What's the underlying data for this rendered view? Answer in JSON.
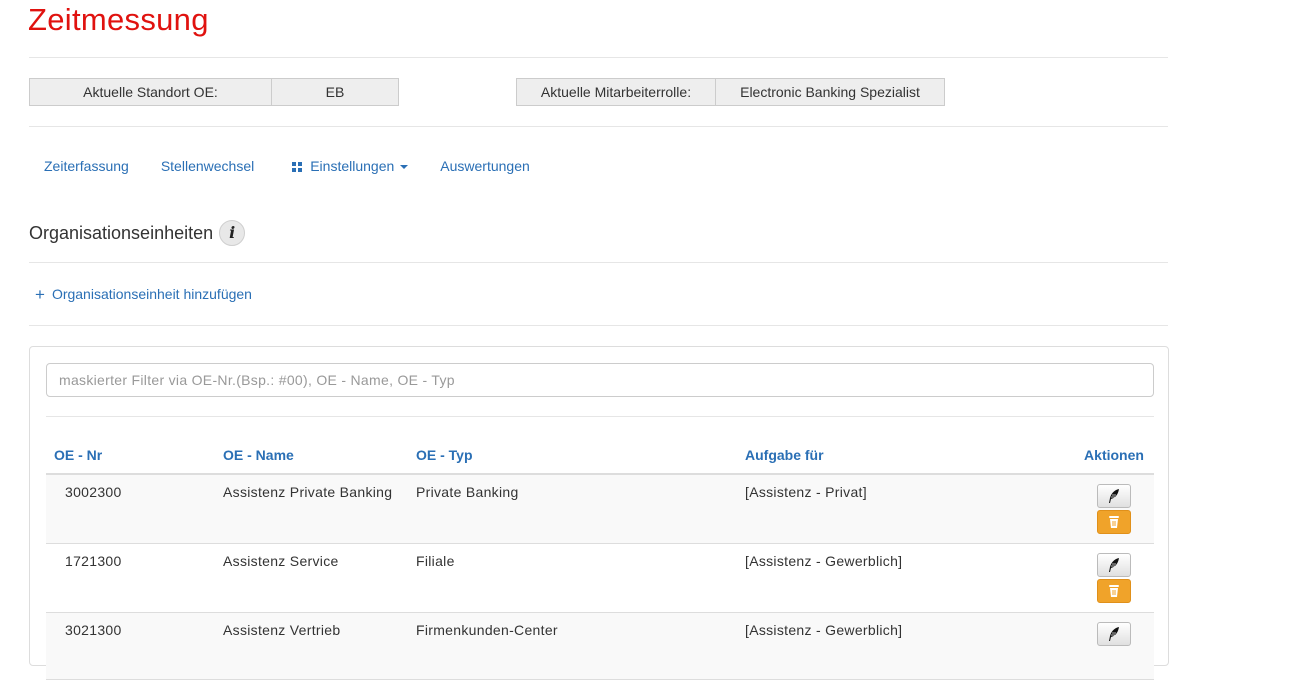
{
  "page": {
    "title": "Zeitmessung"
  },
  "header": {
    "standort_label": "Aktuelle Standort OE:",
    "standort_value": "EB",
    "rolle_label": "Aktuelle Mitarbeiterrolle:",
    "rolle_value": "Electronic Banking Spezialist"
  },
  "nav": {
    "items": [
      {
        "label": "Zeiterfassung"
      },
      {
        "label": "Stellenwechsel"
      },
      {
        "label": "Einstellungen",
        "icon": "grid-icon",
        "dropdown": true
      },
      {
        "label": "Auswertungen"
      }
    ]
  },
  "section": {
    "title": "Organisationseinheiten",
    "info_icon": "info-icon",
    "add_label": "Organisationseinheit hinzufügen"
  },
  "filter": {
    "placeholder": "maskierter Filter via OE-Nr.(Bsp.: #00), OE - Name, OE - Typ",
    "value": ""
  },
  "table": {
    "columns": [
      "OE - Nr",
      "OE - Name",
      "OE - Typ",
      "Aufgabe für",
      "Aktionen"
    ],
    "rows": [
      {
        "nr": "3002300",
        "name": "Assistenz Private Banking",
        "typ": "Private Banking",
        "aufgabe": "[Assistenz - Privat]"
      },
      {
        "nr": "1721300",
        "name": "Assistenz Service",
        "typ": "Filiale",
        "aufgabe": "[Assistenz - Gewerblich]"
      },
      {
        "nr": "3021300",
        "name": "Assistenz Vertrieb",
        "typ": "Firmenkunden-Center",
        "aufgabe": "[Assistenz - Gewerblich]"
      }
    ],
    "actions": {
      "edit_icon": "feather-edit-icon",
      "delete_icon": "trash-icon"
    }
  },
  "colors": {
    "title": "#e0120f",
    "link": "#2a6fb5",
    "delete_button": "#f0a32a"
  }
}
